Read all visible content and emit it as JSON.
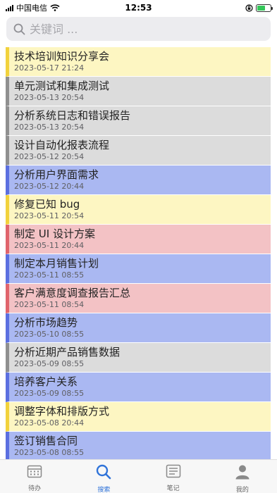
{
  "status_bar": {
    "carrier": "中国电信",
    "time": "12:53"
  },
  "search": {
    "placeholder": "关键词 ..."
  },
  "items": [
    {
      "title": "技术培训知识分享会",
      "date": "2023-05-17 21:24",
      "priority": "yellow"
    },
    {
      "title": "单元测试和集成测试",
      "date": "2023-05-13 20:54",
      "priority": "gray"
    },
    {
      "title": "分析系统日志和错误报告",
      "date": "2023-05-13 20:54",
      "priority": "gray"
    },
    {
      "title": "设计自动化报表流程",
      "date": "2023-05-12 20:54",
      "priority": "gray"
    },
    {
      "title": "分析用户界面需求",
      "date": "2023-05-12 20:44",
      "priority": "blue"
    },
    {
      "title": "修复已知 bug",
      "date": "2023-05-11 20:54",
      "priority": "yellow"
    },
    {
      "title": "制定 UI 设计方案",
      "date": "2023-05-11 20:44",
      "priority": "red"
    },
    {
      "title": "制定本月销售计划",
      "date": "2023-05-11 08:55",
      "priority": "blue"
    },
    {
      "title": "客户满意度调查报告汇总",
      "date": "2023-05-11 08:54",
      "priority": "red"
    },
    {
      "title": "分析市场趋势",
      "date": "2023-05-10 08:55",
      "priority": "blue"
    },
    {
      "title": "分析近期产品销售数据",
      "date": "2023-05-09 08:55",
      "priority": "gray"
    },
    {
      "title": "培养客户关系",
      "date": "2023-05-09 08:55",
      "priority": "blue"
    },
    {
      "title": "调整字体和排版方式",
      "date": "2023-05-08 20:44",
      "priority": "yellow"
    },
    {
      "title": "签订销售合同",
      "date": "2023-05-08 08:55",
      "priority": "blue"
    }
  ],
  "colors": {
    "yellow": {
      "bg": "#fdf6c2",
      "bar": "#f2d23c"
    },
    "gray": {
      "bg": "#dcdcdc",
      "bar": "#8f8f8f"
    },
    "blue": {
      "bg": "#aab8f2",
      "bar": "#5b6fe0"
    },
    "red": {
      "bg": "#f3c2c5",
      "bar": "#e0646c"
    },
    "accent": "#2f73d9"
  },
  "tabs": [
    {
      "label": "待办",
      "icon": "calendar-icon",
      "active": false
    },
    {
      "label": "搜索",
      "icon": "search-icon",
      "active": true
    },
    {
      "label": "笔记",
      "icon": "note-icon",
      "active": false
    },
    {
      "label": "我的",
      "icon": "person-icon",
      "active": false
    }
  ]
}
